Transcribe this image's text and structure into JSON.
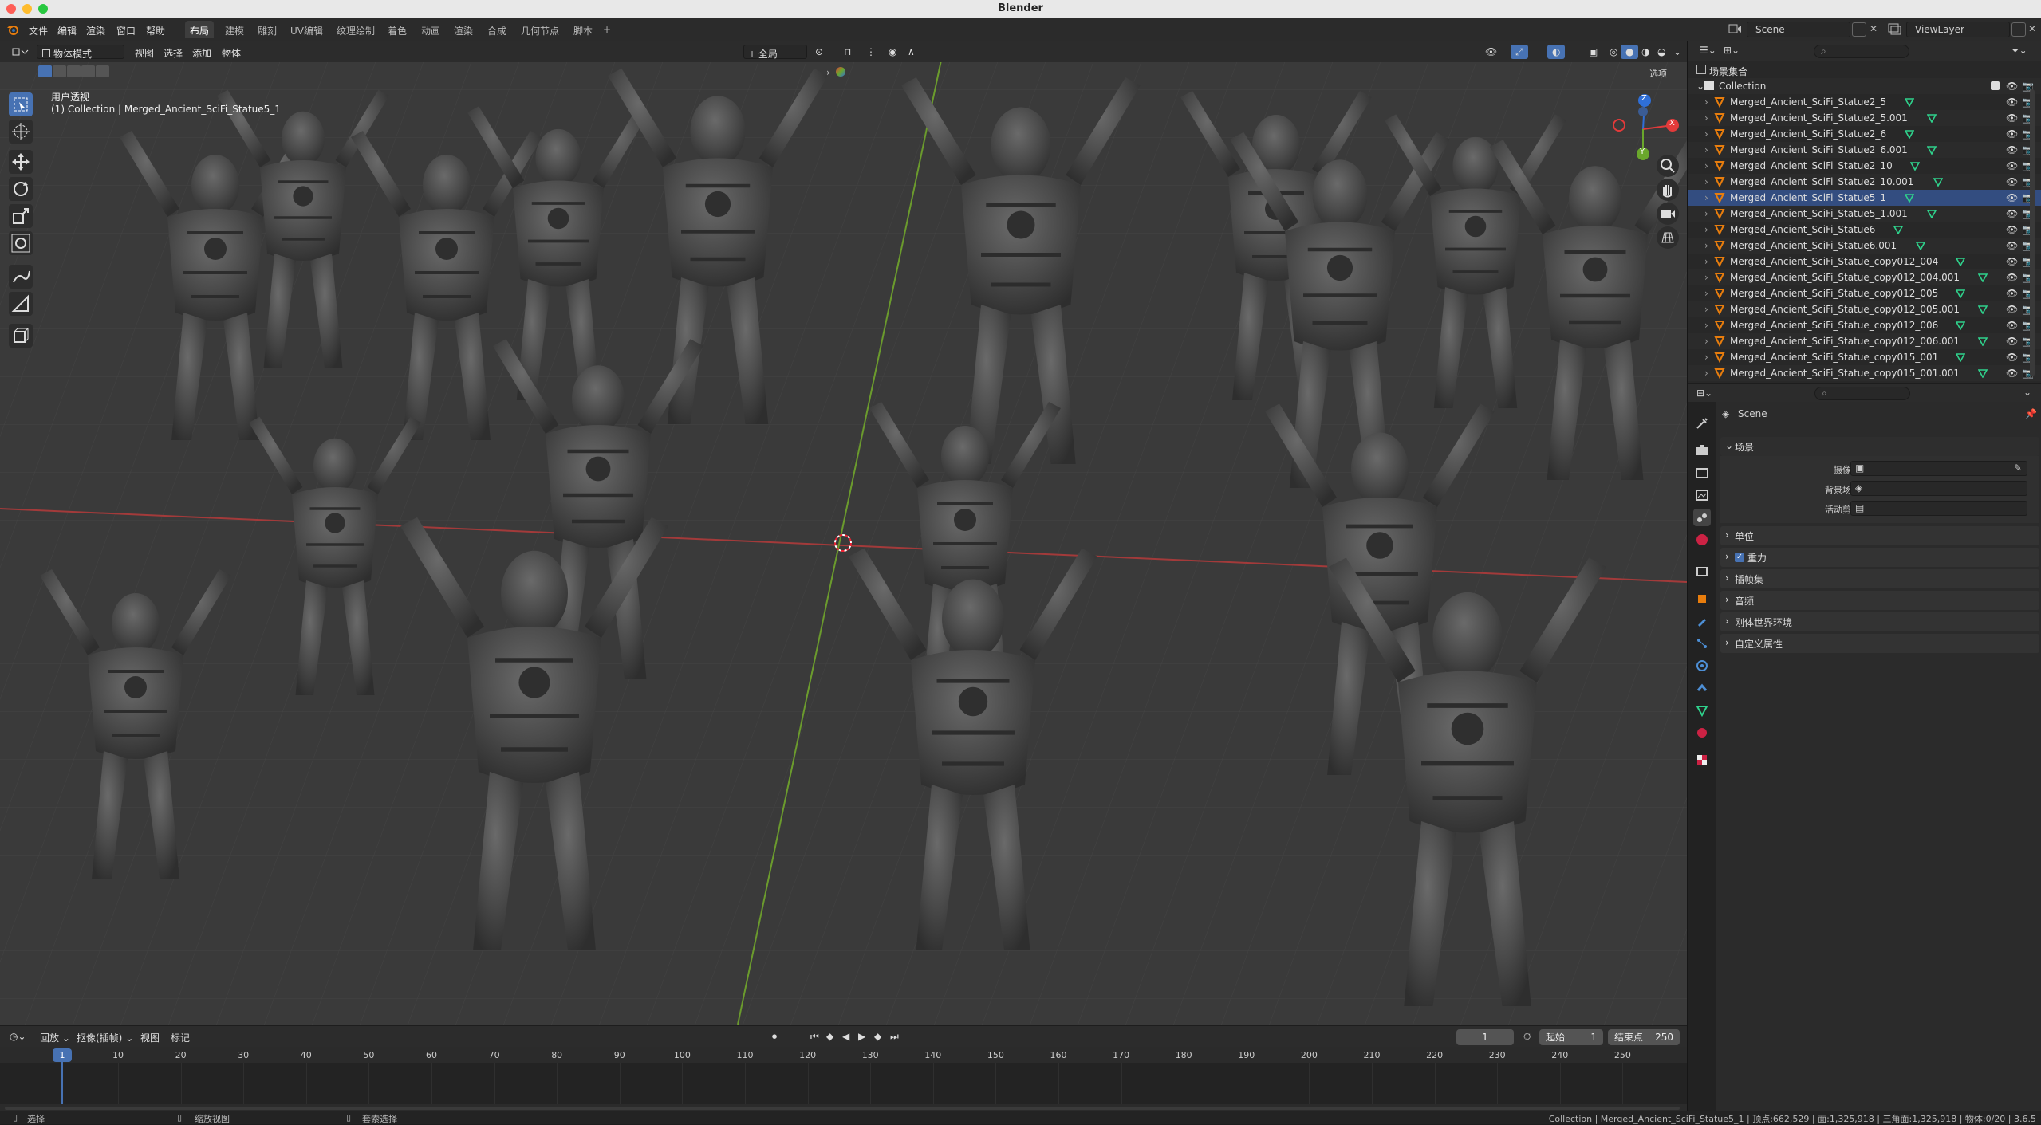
{
  "window": {
    "title": "Blender"
  },
  "menu": [
    "文件",
    "编辑",
    "渲染",
    "窗口",
    "帮助"
  ],
  "workspaces": [
    "布局",
    "建模",
    "雕刻",
    "UV编辑",
    "纹理绘制",
    "着色",
    "动画",
    "渲染",
    "合成",
    "几何节点",
    "脚本"
  ],
  "workspace_add": "+",
  "scene": {
    "name": "Scene",
    "view_layer": "ViewLayer"
  },
  "viewport": {
    "mode": "物体模式",
    "menus": [
      "视图",
      "选择",
      "添加",
      "物体"
    ],
    "orientation": "全局",
    "options_label": "选项",
    "view_name": "用户透视",
    "active_info": "(1) Collection | Merged_Ancient_SciFi_Statue5_1",
    "gizmo": {
      "z": "Z",
      "y": "Y",
      "x": "X"
    }
  },
  "outliner": {
    "root": "场景集合",
    "collection": "Collection",
    "items": [
      "Merged_Ancient_SciFi_Statue2_5",
      "Merged_Ancient_SciFi_Statue2_5.001",
      "Merged_Ancient_SciFi_Statue2_6",
      "Merged_Ancient_SciFi_Statue2_6.001",
      "Merged_Ancient_SciFi_Statue2_10",
      "Merged_Ancient_SciFi_Statue2_10.001",
      "Merged_Ancient_SciFi_Statue5_1",
      "Merged_Ancient_SciFi_Statue5_1.001",
      "Merged_Ancient_SciFi_Statue6",
      "Merged_Ancient_SciFi_Statue6.001",
      "Merged_Ancient_SciFi_Statue_copy012_004",
      "Merged_Ancient_SciFi_Statue_copy012_004.001",
      "Merged_Ancient_SciFi_Statue_copy012_005",
      "Merged_Ancient_SciFi_Statue_copy012_005.001",
      "Merged_Ancient_SciFi_Statue_copy012_006",
      "Merged_Ancient_SciFi_Statue_copy012_006.001",
      "Merged_Ancient_SciFi_Statue_copy015_001",
      "Merged_Ancient_SciFi_Statue_copy015_001.001"
    ]
  },
  "properties": {
    "context": "Scene",
    "panel_scene": "场景",
    "camera_label": "摄像机",
    "background_label": "背景场景",
    "clip_label": "活动剪辑",
    "sections": [
      "单位",
      "重力",
      "插帧集",
      "音频",
      "刚体世界环境",
      "自定义属性"
    ]
  },
  "timeline": {
    "menus": [
      "回放",
      "抠像(插帧)",
      "视图",
      "标记"
    ],
    "current_frame": "1",
    "start_label": "起始",
    "start": "1",
    "end_label": "结束点",
    "end": "250",
    "ticks": [
      "10",
      "20",
      "30",
      "40",
      "50",
      "60",
      "70",
      "80",
      "90",
      "100",
      "110",
      "120",
      "130",
      "140",
      "150",
      "160",
      "170",
      "180",
      "190",
      "200",
      "210",
      "220",
      "230",
      "240",
      "250"
    ],
    "playhead": "1"
  },
  "status": {
    "left1": "选择",
    "left2": "缩放视图",
    "left3": "套索选择",
    "right": "Collection | Merged_Ancient_SciFi_Statue5_1 | 顶点:662,529 | 面:1,325,918 | 三角面:1,325,918 | 物体:0/20 | 3.6.5"
  }
}
